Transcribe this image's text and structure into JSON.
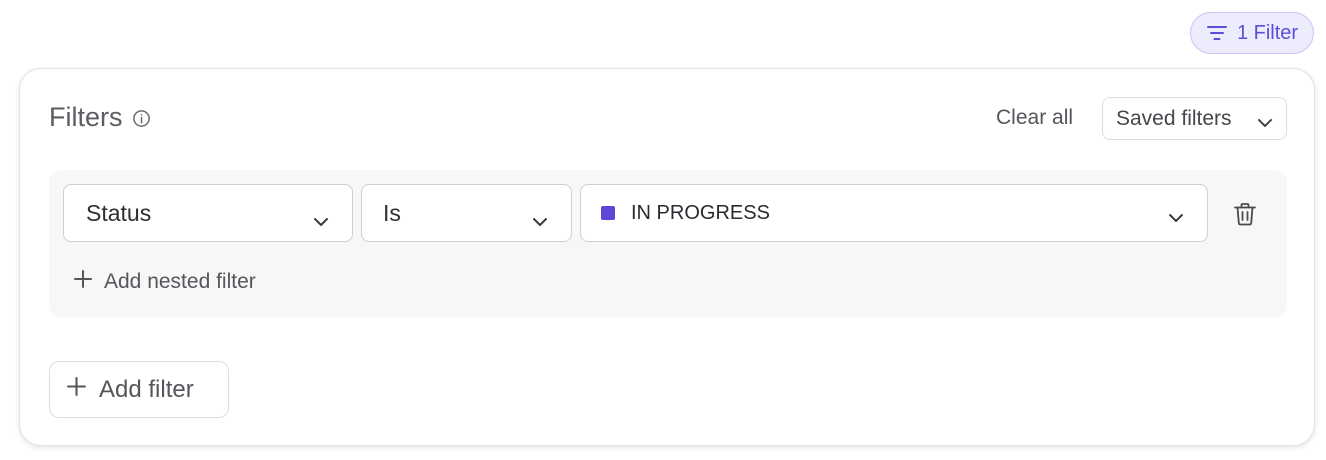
{
  "filter_chip": {
    "label": "1 Filter",
    "icon": "filter-lines-icon",
    "color": "#5a4fd8"
  },
  "panel": {
    "title": "Filters",
    "info_icon": "info-icon",
    "clear_all_label": "Clear all",
    "saved_filters_label": "Saved filters"
  },
  "filter_row": {
    "field": "Status",
    "operator": "Is",
    "value": "IN PROGRESS",
    "value_color": "#5b49d6",
    "delete_icon": "trash-icon"
  },
  "add_nested_label": "Add nested filter",
  "add_filter_label": "Add filter"
}
